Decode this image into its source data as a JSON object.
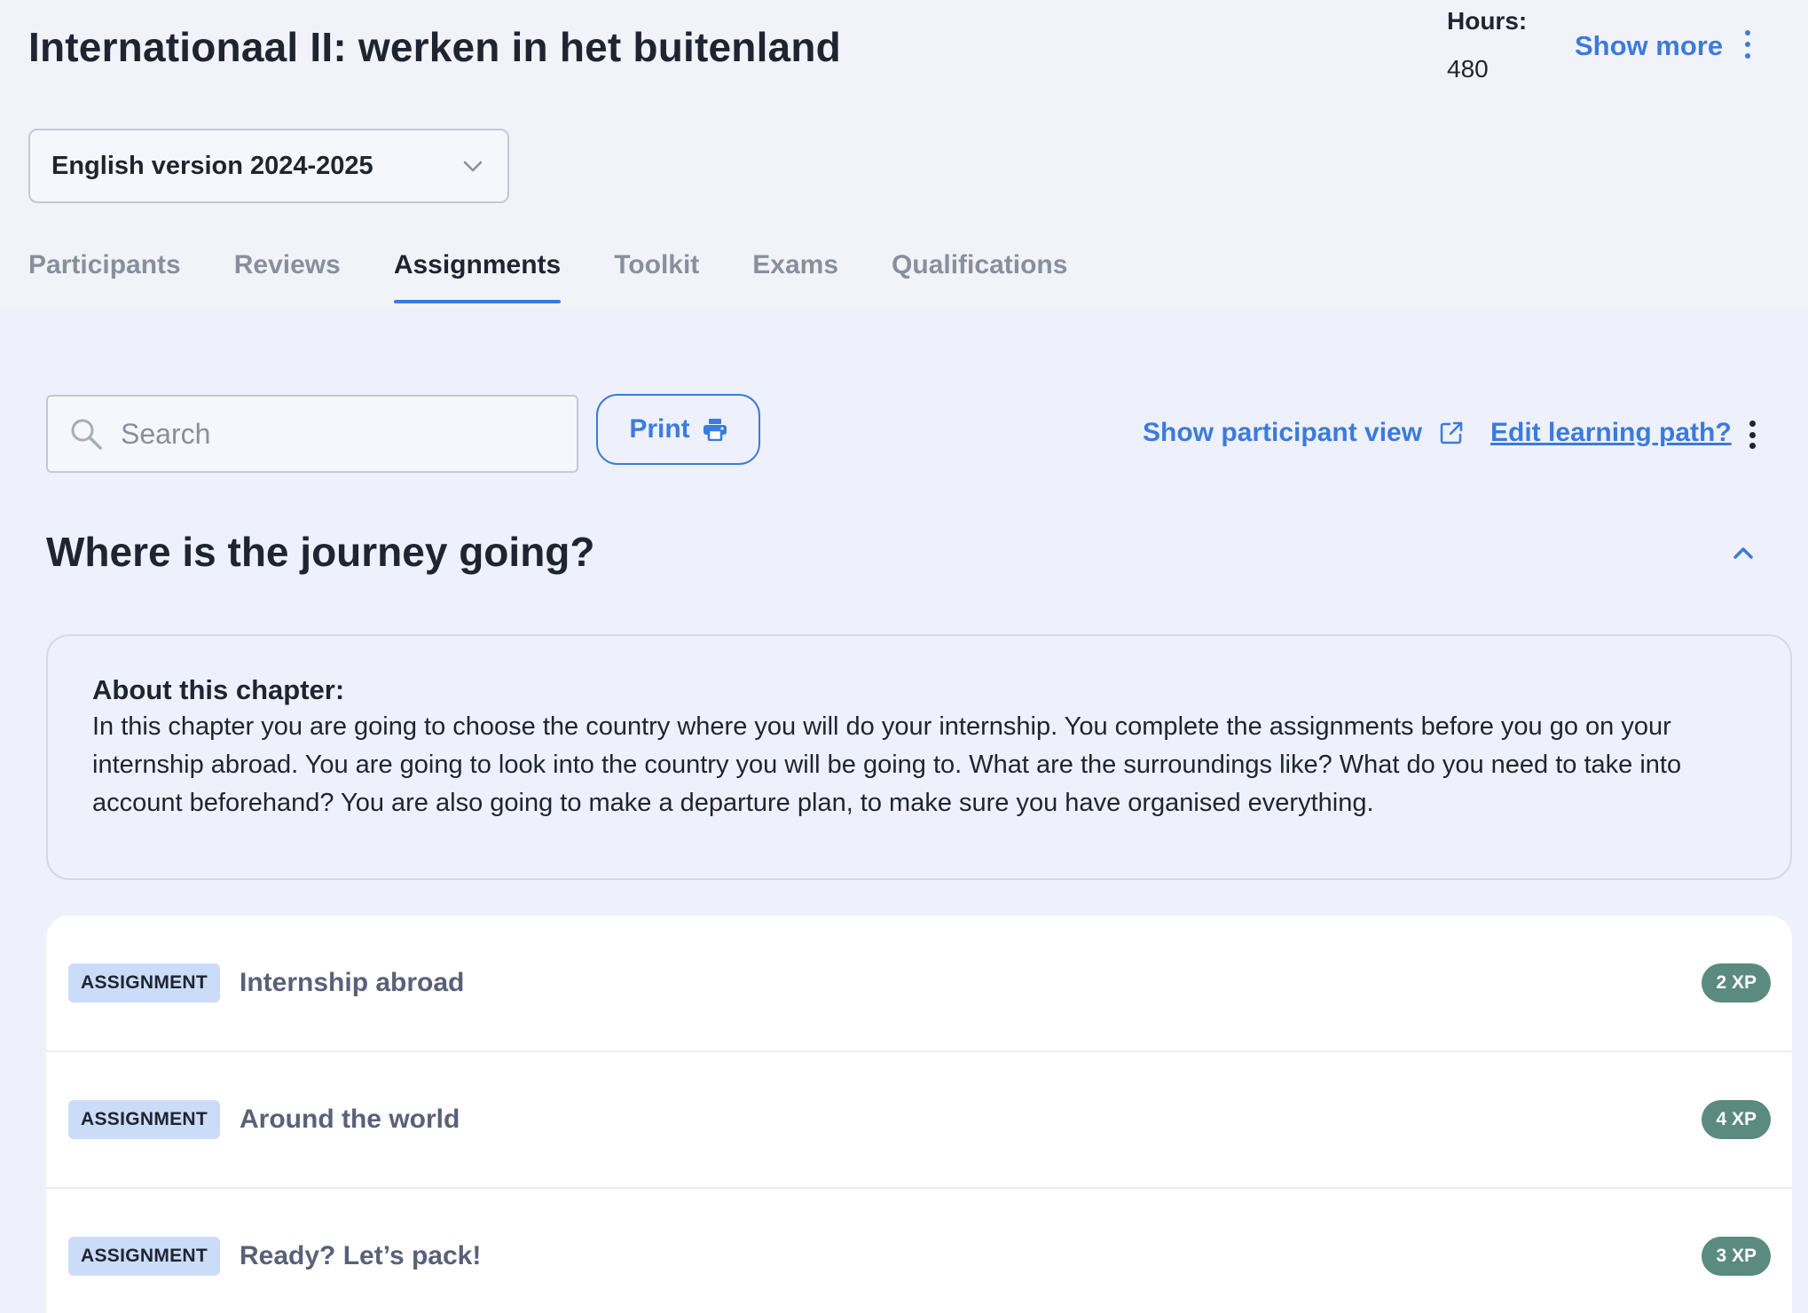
{
  "header": {
    "title": "Internationaal II: werken in het buitenland",
    "hours_label": "Hours:",
    "hours_value": "480",
    "show_more_label": "Show more"
  },
  "version_select": {
    "value": "English version 2024-2025"
  },
  "tabs": [
    {
      "label": "Participants",
      "active": false
    },
    {
      "label": "Reviews",
      "active": false
    },
    {
      "label": "Assignments",
      "active": true
    },
    {
      "label": "Toolkit",
      "active": false
    },
    {
      "label": "Exams",
      "active": false
    },
    {
      "label": "Qualifications",
      "active": false
    }
  ],
  "toolbar": {
    "search_placeholder": "Search",
    "print_label": "Print",
    "participant_view_label": "Show participant view",
    "edit_path_label": "Edit learning path?"
  },
  "chapter": {
    "title": "Where is the journey going?",
    "about_heading": "About this chapter:",
    "about_text": "In this chapter you are going to choose the country where you will do your internship. You complete the assignments before you go on your internship abroad. You are going to look into the country you will be going to. What are the surroundings like? What do you need to take into account beforehand? You are also going to make a departure plan, to make sure you have organised everything."
  },
  "assignments": [
    {
      "badge": "ASSIGNMENT",
      "title": "Internship abroad",
      "xp": "2 XP"
    },
    {
      "badge": "ASSIGNMENT",
      "title": "Around the world",
      "xp": "4 XP"
    },
    {
      "badge": "ASSIGNMENT",
      "title": "Ready? Let’s pack!",
      "xp": "3 XP"
    }
  ],
  "colors": {
    "accent": "#3b7bdc",
    "page_bg": "#eef1fb",
    "badge_bg": "#cbdcf8",
    "xp_bg": "#5b8a7e"
  }
}
